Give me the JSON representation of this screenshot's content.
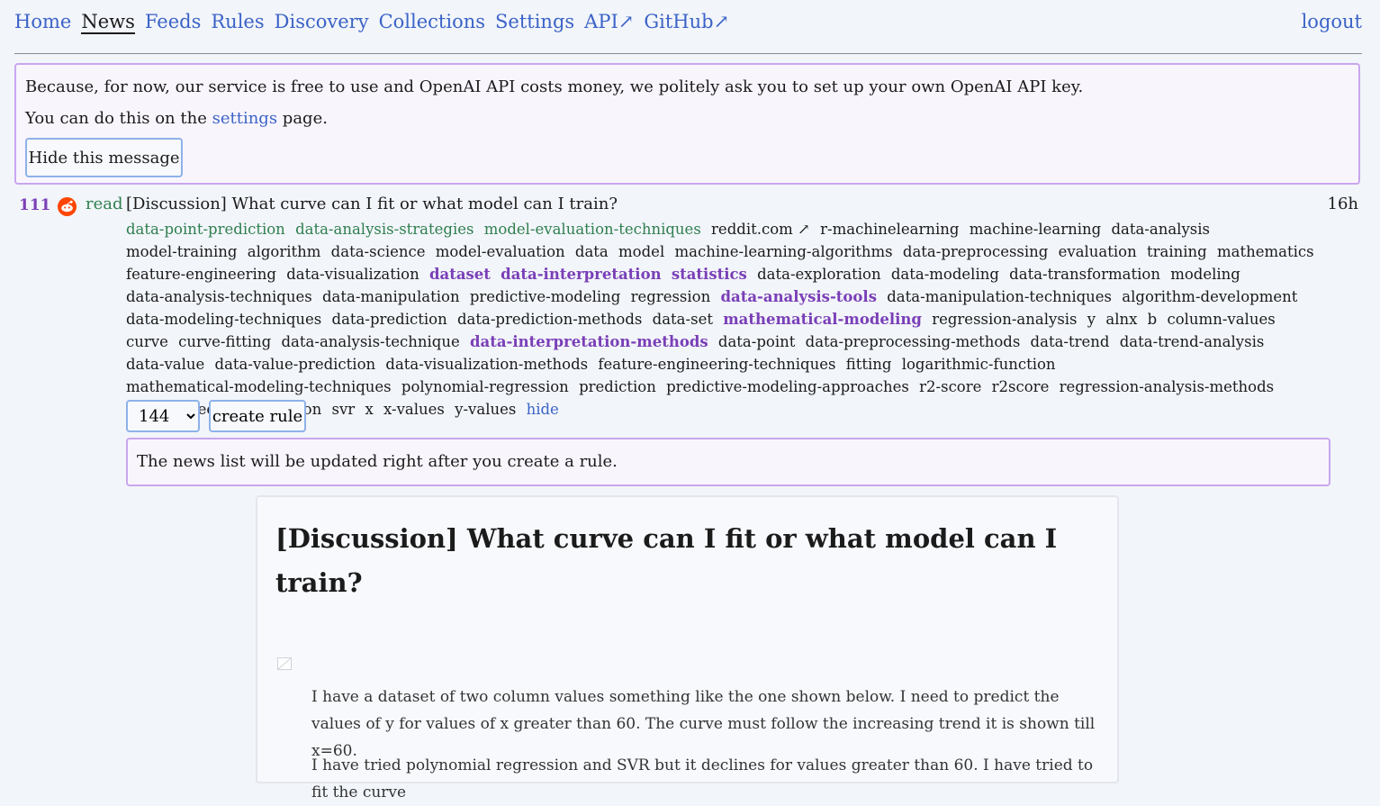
{
  "nav": {
    "items": [
      "Home",
      "News",
      "Feeds",
      "Rules",
      "Discovery",
      "Collections",
      "Settings",
      "API↗",
      "GitHub↗"
    ],
    "active_index": 1,
    "logout": "logout"
  },
  "notice": {
    "line1": "Because, for now, our service is free to use and OpenAI API costs money, we politely ask you to set up your own OpenAI API key.",
    "line2_prefix": "You can do this on the",
    "line2_link": "settings",
    "line2_suffix": "page.",
    "hide_button": "Hide this message"
  },
  "entry": {
    "score": "111",
    "read_label": "read",
    "title": "[Discussion] What curve can I fit or what model can I train?",
    "age": "16h",
    "tags": [
      {
        "text": "data-point-prediction",
        "style": "g"
      },
      {
        "text": "data-analysis-strategies",
        "style": "g"
      },
      {
        "text": "model-evaluation-techniques",
        "style": "g"
      },
      {
        "text": "reddit.com ↗",
        "style": "d"
      },
      {
        "text": "r-machinelearning",
        "style": "d"
      },
      {
        "text": "machine-learning",
        "style": "d"
      },
      {
        "text": "data-analysis",
        "style": "d"
      },
      {
        "text": "model-training",
        "style": "d"
      },
      {
        "text": "algorithm",
        "style": "d"
      },
      {
        "text": "data-science",
        "style": "d"
      },
      {
        "text": "model-evaluation",
        "style": "d"
      },
      {
        "text": "data",
        "style": "d"
      },
      {
        "text": "model",
        "style": "d"
      },
      {
        "text": "machine-learning-algorithms",
        "style": "d"
      },
      {
        "text": "data-preprocessing",
        "style": "d"
      },
      {
        "text": "evaluation",
        "style": "d"
      },
      {
        "text": "training",
        "style": "d"
      },
      {
        "text": "mathematics",
        "style": "d"
      },
      {
        "text": "feature-engineering",
        "style": "d"
      },
      {
        "text": "data-visualization",
        "style": "d"
      },
      {
        "text": "dataset",
        "style": "p"
      },
      {
        "text": "data-interpretation",
        "style": "p"
      },
      {
        "text": "statistics",
        "style": "p"
      },
      {
        "text": "data-exploration",
        "style": "d"
      },
      {
        "text": "data-modeling",
        "style": "d"
      },
      {
        "text": "data-transformation",
        "style": "d"
      },
      {
        "text": "modeling",
        "style": "d"
      },
      {
        "text": "data-analysis-techniques",
        "style": "d"
      },
      {
        "text": "data-manipulation",
        "style": "d"
      },
      {
        "text": "predictive-modeling",
        "style": "d"
      },
      {
        "text": "regression",
        "style": "d"
      },
      {
        "text": "data-analysis-tools",
        "style": "p"
      },
      {
        "text": "data-manipulation-techniques",
        "style": "d"
      },
      {
        "text": "algorithm-development",
        "style": "d"
      },
      {
        "text": "data-modeling-techniques",
        "style": "d"
      },
      {
        "text": "data-prediction",
        "style": "d"
      },
      {
        "text": "data-prediction-methods",
        "style": "d"
      },
      {
        "text": "data-set",
        "style": "d"
      },
      {
        "text": "mathematical-modeling",
        "style": "p"
      },
      {
        "text": "regression-analysis",
        "style": "d"
      },
      {
        "text": "y",
        "style": "d"
      },
      {
        "text": "alnx",
        "style": "d"
      },
      {
        "text": "b",
        "style": "d"
      },
      {
        "text": "column-values",
        "style": "d"
      },
      {
        "text": "curve",
        "style": "d"
      },
      {
        "text": "curve-fitting",
        "style": "d"
      },
      {
        "text": "data-analysis-technique",
        "style": "d"
      },
      {
        "text": "data-interpretation-methods",
        "style": "p"
      },
      {
        "text": "data-point",
        "style": "d"
      },
      {
        "text": "data-preprocessing-methods",
        "style": "d"
      },
      {
        "text": "data-trend",
        "style": "d"
      },
      {
        "text": "data-trend-analysis",
        "style": "d"
      },
      {
        "text": "data-value",
        "style": "d"
      },
      {
        "text": "data-value-prediction",
        "style": "d"
      },
      {
        "text": "data-visualization-methods",
        "style": "d"
      },
      {
        "text": "feature-engineering-techniques",
        "style": "d"
      },
      {
        "text": "fitting",
        "style": "d"
      },
      {
        "text": "logarithmic-function",
        "style": "d"
      },
      {
        "text": "mathematical-modeling-techniques",
        "style": "d"
      },
      {
        "text": "polynomial-regression",
        "style": "d"
      },
      {
        "text": "prediction",
        "style": "d"
      },
      {
        "text": "predictive-modeling-approaches",
        "style": "d"
      },
      {
        "text": "r2-score",
        "style": "d"
      },
      {
        "text": "r2score",
        "style": "d"
      },
      {
        "text": "regression-analysis-methods",
        "style": "d"
      },
      {
        "text": "support-vector-regression",
        "style": "d"
      },
      {
        "text": "svr",
        "style": "d"
      },
      {
        "text": "x",
        "style": "d"
      },
      {
        "text": "x-values",
        "style": "d"
      },
      {
        "text": "y-values",
        "style": "d"
      },
      {
        "text": "hide",
        "style": "h"
      }
    ],
    "rule_score_value": "144",
    "create_rule_button": "create rule",
    "rule_note": "The news list will be updated right after you create a rule."
  },
  "article": {
    "title": "[Discussion] What curve can I fit or what model can I train?",
    "paragraph1": "I have a dataset of two column values something like the one shown below. I need to predict the values of y for values of x greater than 60. The curve must follow the increasing trend it is shown till x=60.",
    "paragraph2": "I have tried polynomial regression and SVR but it declines for values greater than 60. I have tried to fit the curve"
  },
  "colors": {
    "link": "#3b63c7",
    "green_tag": "#2f7f4f",
    "purple_tag": "#7a3fb7",
    "notice_border": "#c9a6ee",
    "button_border": "#8db2e9",
    "reddit": "#ff4500"
  }
}
